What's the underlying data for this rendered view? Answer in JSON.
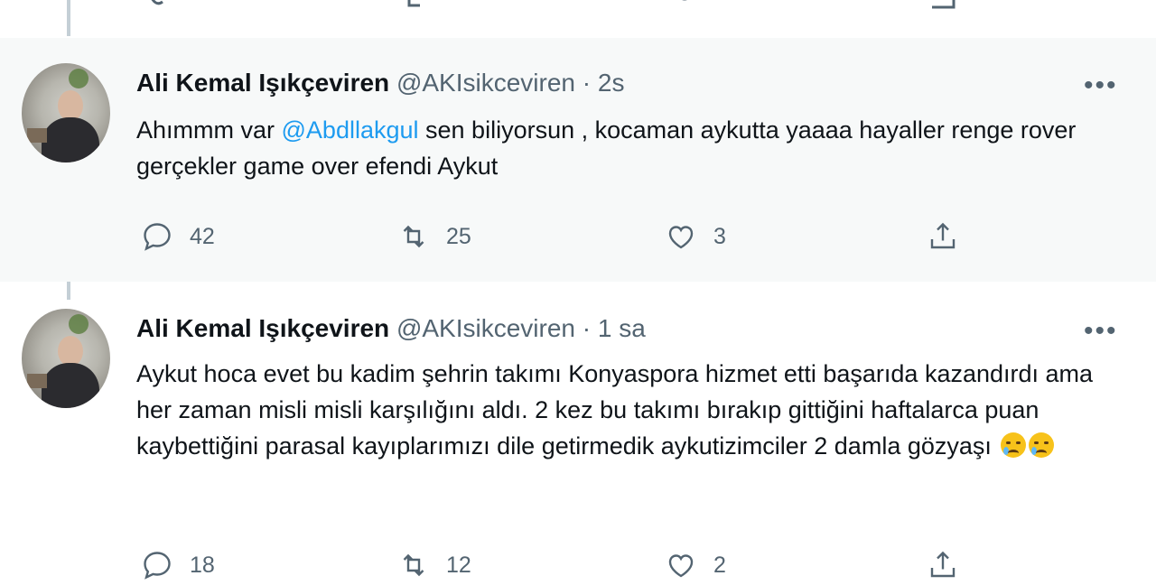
{
  "tweets": [
    {
      "author": {
        "name": "Ali Kemal Işıkçeviren",
        "handle": "@AKIsikceviren",
        "time": "2s"
      },
      "text": {
        "before": "Ahımmm var ",
        "mention": "@Abdllakgul",
        "after": "  sen biliyorsun , kocaman aykutta yaaaa hayaller renge rover gerçekler game over efendi Aykut"
      },
      "actions": {
        "replies": "42",
        "retweets": "25",
        "likes": "3"
      }
    },
    {
      "author": {
        "name": "Ali Kemal Işıkçeviren",
        "handle": "@AKIsikceviren",
        "time": "1 sa"
      },
      "text": {
        "body": "Aykut hoca evet bu kadim şehrin takımı Konyaspora hizmet etti başarıda kazandırdı ama her zaman misli misli karşılığını aldı. 2 kez bu takımı bırakıp gittiğini haftalarca puan kaybettiğini  parasal kayıplarımızı dile getirmedik aykutizimciler 2 damla gözyaşı"
      },
      "actions": {
        "replies": "18",
        "retweets": "12",
        "likes": "2"
      }
    }
  ],
  "dot": "·",
  "more_label": "•••",
  "icons": {
    "reply": "reply-icon",
    "retweet": "retweet-icon",
    "like": "heart-icon",
    "share": "share-icon",
    "more": "more-icon"
  },
  "colors": {
    "link": "#1d9bf0",
    "muted": "#536471",
    "highlight": "#f7f9f9",
    "thread": "#c4cfd6"
  }
}
